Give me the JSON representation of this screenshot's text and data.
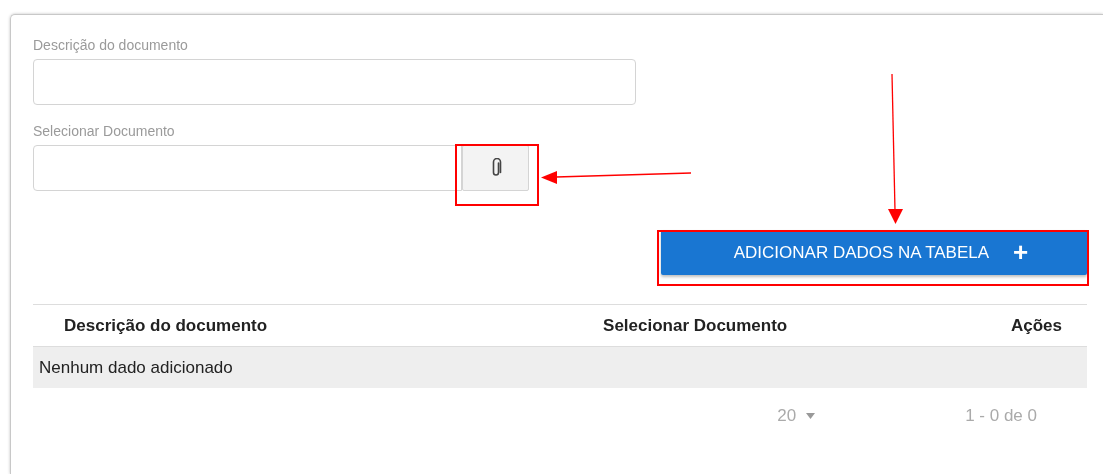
{
  "form": {
    "fields": [
      {
        "label": "Descrição do documento",
        "kind": "text"
      },
      {
        "label": "Selecionar Documento",
        "kind": "file"
      }
    ],
    "add_button": {
      "label": "ADICIONAR DADOS NA TABELA",
      "icon": "+"
    }
  },
  "table": {
    "columns": [
      {
        "label": "Descrição do documento"
      },
      {
        "label": "Selecionar Documento"
      },
      {
        "label": "Ações"
      }
    ],
    "empty_message": "Nenhum dado adicionado",
    "pagination": {
      "page_size": "20",
      "range": "1 - 0 de 0"
    }
  }
}
